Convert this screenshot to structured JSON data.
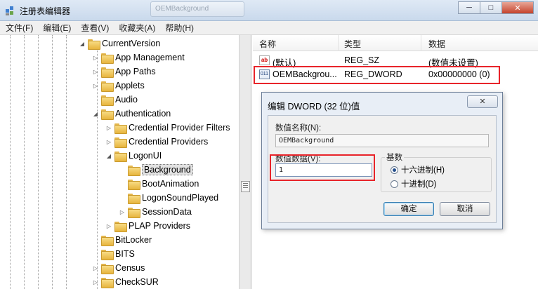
{
  "window": {
    "title": "注册表编辑器",
    "background_tab_label": "OEMBackground",
    "buttons": {
      "minimize": "─",
      "maximize": "□",
      "close": "✕"
    }
  },
  "menubar": [
    "文件(F)",
    "编辑(E)",
    "查看(V)",
    "收藏夹(A)",
    "帮助(H)"
  ],
  "tree": {
    "nodes": [
      {
        "label": "CurrentVersion",
        "depth": 0,
        "expander": "expanded"
      },
      {
        "label": "App Management",
        "depth": 1,
        "expander": "collapsed"
      },
      {
        "label": "App Paths",
        "depth": 1,
        "expander": "collapsed"
      },
      {
        "label": "Applets",
        "depth": 1,
        "expander": "collapsed"
      },
      {
        "label": "Audio",
        "depth": 1,
        "expander": "none"
      },
      {
        "label": "Authentication",
        "depth": 1,
        "expander": "expanded"
      },
      {
        "label": "Credential Provider Filters",
        "depth": 2,
        "expander": "collapsed"
      },
      {
        "label": "Credential Providers",
        "depth": 2,
        "expander": "collapsed"
      },
      {
        "label": "LogonUI",
        "depth": 2,
        "expander": "expanded"
      },
      {
        "label": "Background",
        "depth": 3,
        "expander": "none",
        "selected": true
      },
      {
        "label": "BootAnimation",
        "depth": 3,
        "expander": "none"
      },
      {
        "label": "LogonSoundPlayed",
        "depth": 3,
        "expander": "none"
      },
      {
        "label": "SessionData",
        "depth": 3,
        "expander": "collapsed"
      },
      {
        "label": "PLAP Providers",
        "depth": 2,
        "expander": "collapsed"
      },
      {
        "label": "BitLocker",
        "depth": 1,
        "expander": "none"
      },
      {
        "label": "BITS",
        "depth": 1,
        "expander": "none"
      },
      {
        "label": "Census",
        "depth": 1,
        "expander": "collapsed"
      },
      {
        "label": "CheckSUR",
        "depth": 1,
        "expander": "collapsed"
      }
    ]
  },
  "list": {
    "columns": [
      "名称",
      "类型",
      "数据"
    ],
    "rows": [
      {
        "icon": "string-value-icon",
        "icon_text": "ab",
        "name": "(默认)",
        "type": "REG_SZ",
        "data": "(数值未设置)"
      },
      {
        "icon": "binary-value-icon",
        "icon_text": "011",
        "name": "OEMBackgrou...",
        "type": "REG_DWORD",
        "data": "0x00000000 (0)"
      }
    ]
  },
  "dialog": {
    "title": "编辑 DWORD (32 位)值",
    "close": "✕",
    "value_name_label": "数值名称(N):",
    "value_name": "OEMBackground",
    "value_data_label": "数值数据(V):",
    "value_data": "1",
    "base_label": "基数",
    "base_hex": "十六进制(H)",
    "base_dec": "十进制(D)",
    "ok": "确定",
    "cancel": "取消"
  },
  "colors": {
    "highlight": "#e8242a",
    "accent": "#3c7fb1"
  }
}
